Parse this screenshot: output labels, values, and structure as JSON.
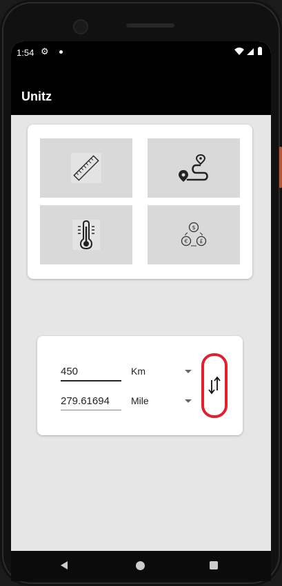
{
  "status": {
    "time": "1:54"
  },
  "app": {
    "title": "Unitz"
  },
  "categories": [
    {
      "icon": "ruler-icon"
    },
    {
      "icon": "route-icon"
    },
    {
      "icon": "thermometer-icon"
    },
    {
      "icon": "currency-icon"
    }
  ],
  "converter": {
    "from_value": "450",
    "from_unit": "Km",
    "to_value": "279.61694",
    "to_unit": "Mile",
    "swap_icon": "swap-vertical-icon"
  },
  "colors": {
    "accent_highlight": "#e0202f",
    "tile_bg": "#d8d9d8",
    "screen_bg": "#e6e6e6"
  }
}
